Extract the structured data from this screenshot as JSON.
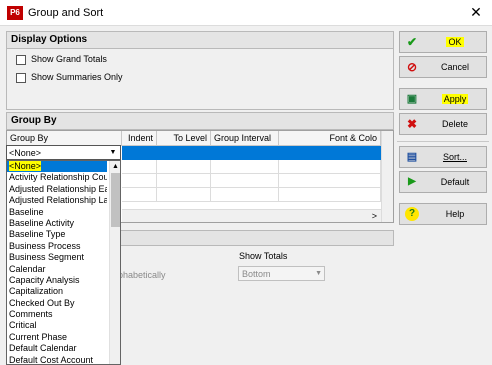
{
  "window": {
    "app_badge": "P6",
    "title": "Group and Sort",
    "close_glyph": "✕"
  },
  "display_options": {
    "header": "Display Options",
    "show_grand_totals": {
      "label": "Show Grand Totals",
      "checked": false
    },
    "show_summaries_only": {
      "label": "Show Summaries Only",
      "checked": false
    }
  },
  "group_by": {
    "header": "Group By",
    "columns": [
      "Group By",
      "Indent",
      "To Level",
      "Group Interval",
      "Font & Colo"
    ],
    "selected_value": "<None>",
    "scroll_right_glyph": ">",
    "options": [
      "<None>",
      "Activity Relationship Cou",
      "Adjusted Relationship Ea",
      "Adjusted Relationship Lat",
      "Baseline",
      "Baseline Activity",
      "Baseline Type",
      "Business Process",
      "Business Segment",
      "Calendar",
      "Capacity Analysis",
      "Capitalization",
      "Checked Out By",
      "Comments",
      "Critical",
      "Current Phase",
      "Default Calendar",
      "Default Cost Account"
    ]
  },
  "sorting": {
    "alphabetically_label": "phabetically",
    "show_totals_label": "Show Totals",
    "show_totals_value": "Bottom"
  },
  "buttons": {
    "ok": "OK",
    "cancel": "Cancel",
    "apply": "Apply",
    "delete": "Delete",
    "sort": "Sort...",
    "default": "Default",
    "help": "Help"
  },
  "colors": {
    "highlight": "#ffff00",
    "selection": "#0078d7",
    "app_red": "#c00000"
  }
}
